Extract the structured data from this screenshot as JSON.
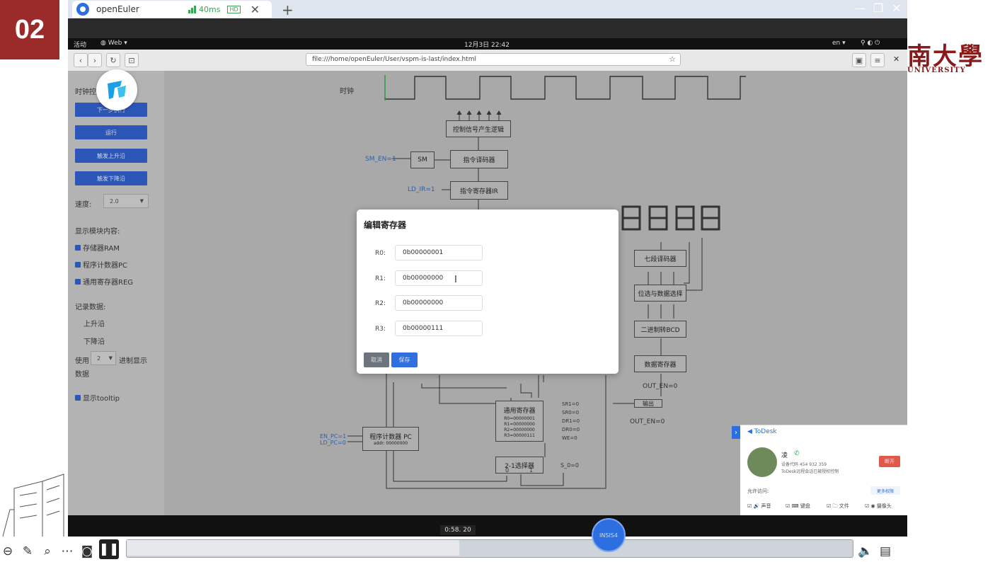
{
  "slide": {
    "number": "02"
  },
  "university_logo": {
    "chars": "南大學",
    "sub": "UNIVERSITY"
  },
  "todesk_window": {
    "tab_title": "openEuler",
    "latency": "40ms",
    "hd_badge": "HD",
    "close_glyph": "✕",
    "new_tab_glyph": "+",
    "window_controls": [
      "—",
      "❐",
      "✕"
    ]
  },
  "gnome_bar": {
    "activities": "活动",
    "app_menu": "Web ▾",
    "datetime": "12月3日  22:42",
    "lang": "en ▾"
  },
  "browser": {
    "url": "file:///home/openEuler/User/vspm-is-last/index.html",
    "star": "☆"
  },
  "sidebar": {
    "section_label": "时钟控",
    "buttons": [
      "下一步执行",
      "运行",
      "触发上升沿",
      "触发下降沿"
    ],
    "speed_label": "速度:",
    "speed_value": "2.0",
    "display_label": "显示模块内容:",
    "checks": [
      "存储器RAM",
      "程序计数器PC",
      "通用寄存器REG"
    ],
    "record_label": "记录数据:",
    "record_items": [
      "上升沿",
      "下降沿"
    ],
    "radix_prefix": "使用",
    "radix_value": "2",
    "radix_suffix": "进制显示",
    "radix_tail": "数据",
    "tooltip_check": "显示tooltip"
  },
  "circuit": {
    "clock_label": "时钟",
    "control_logic": "控制信号产生逻辑",
    "sm_signal": "SM_EN=1",
    "sm": "SM",
    "decoder": "指令译码器",
    "ld_ir": "LD_IR=1",
    "ir": "指令寄存器IR",
    "seg_decoder": "七段译码器",
    "bit_select": "位选与数据选择",
    "bin2bcd": "二进制转BCD",
    "data_reg": "数据寄存器",
    "out_en_top": "OUT_EN=0",
    "out_box": "输出",
    "out_en_bottom": "OUT_EN=0",
    "gpr": "通用寄存器",
    "gpr_rows": [
      "R0=00000001",
      "R1=00000000",
      "R2=00000000",
      "R3=00000111"
    ],
    "gpr_signals": [
      "SR1=0",
      "SR0=0",
      "DR1=0",
      "DR0=0",
      "WE=0"
    ],
    "pc": "程序计数器 PC",
    "pc_value": "addr: 00000000",
    "pc_signals": [
      "EN_PC=1",
      "LD_PC=0"
    ],
    "mux": "2-1选择器",
    "mux_signal": "S_0=0",
    "mux_pins": [
      "0",
      "1"
    ]
  },
  "modal": {
    "title": "编辑寄存器",
    "registers": [
      {
        "label": "R0:",
        "value": "0b00000001"
      },
      {
        "label": "R1:",
        "value": "0b00000000"
      },
      {
        "label": "R2:",
        "value": "0b00000000"
      },
      {
        "label": "R3:",
        "value": "0b00000111"
      }
    ],
    "cancel_label": "取消",
    "save_label": "保存"
  },
  "todesk_panel": {
    "brand": "ToDesk",
    "user_name": "凌",
    "device_line": "设备代码 454 932 359",
    "status_line": "ToDesk远程会话已被授权控制",
    "end_button": "断开",
    "permissions_label": "允许访问:",
    "more_label": "更多权限",
    "perms": [
      "声音",
      "键盘",
      "文件",
      "摄像头"
    ]
  },
  "player": {
    "timestamp": "0:58. 20",
    "circle_label": "INSIS4"
  },
  "colors": {
    "accent_blue": "#2b56b8",
    "slide_red": "#9b2a2a",
    "modal_save": "#2f6fe0"
  }
}
